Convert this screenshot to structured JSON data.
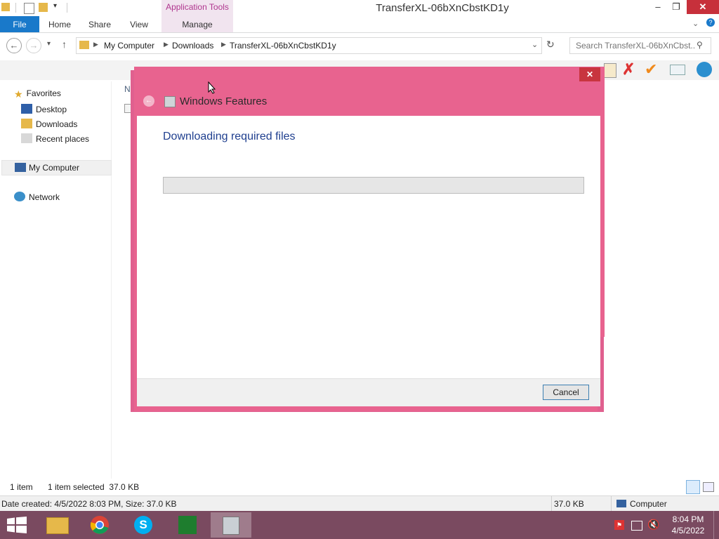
{
  "window": {
    "title": "TransferXL-06bXnCbstKD1y",
    "contextual_group": "Application Tools",
    "controls": [
      "–",
      "❐",
      "✕"
    ]
  },
  "ribbon": {
    "tabs": [
      "File",
      "Home",
      "Share",
      "View",
      "Manage"
    ]
  },
  "address": {
    "crumbs": [
      "My Computer",
      "Downloads",
      "TransferXL-06bXnCbstKD1y"
    ],
    "search_placeholder": "Search TransferXL-06bXnCbst..."
  },
  "nav_pane": {
    "favorites": "Favorites",
    "favorite_items": [
      "Desktop",
      "Downloads",
      "Recent places"
    ],
    "computer": "My Computer",
    "network": "Network"
  },
  "file_list": {
    "column_name": "Na"
  },
  "dialog": {
    "title": "Windows Features",
    "heading": "Downloading required files",
    "progress": 0,
    "cancel_label": "Cancel"
  },
  "status": {
    "item_count": "1 item",
    "selected": "1 item selected  37.0 KB",
    "details": "Date created: 4/5/2022 8:03 PM, Size: 37.0 KB",
    "size": "37.0 KB",
    "location": "Computer"
  },
  "taskbar": {
    "apps": [
      "file-explorer",
      "chrome",
      "skype",
      "task-manager",
      "windows-features"
    ],
    "time": "8:04 PM",
    "date": "4/5/2022"
  },
  "colors": {
    "dialog_border": "#e8638f",
    "file_tab": "#1979ca",
    "taskbar": "#7a4a60",
    "heading": "#1f3f8f"
  }
}
